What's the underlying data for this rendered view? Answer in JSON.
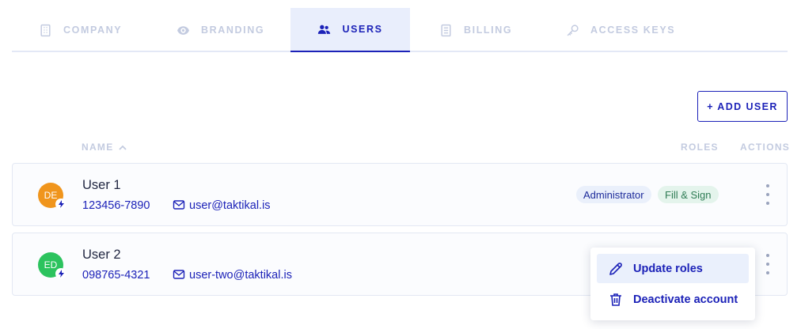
{
  "tabs": [
    {
      "label": "COMPANY",
      "icon": "building-icon"
    },
    {
      "label": "BRANDING",
      "icon": "eye-icon"
    },
    {
      "label": "USERS",
      "icon": "users-icon",
      "active": true
    },
    {
      "label": "BILLING",
      "icon": "document-icon"
    },
    {
      "label": "ACCESS KEYS",
      "icon": "key-icon"
    }
  ],
  "add_user_label": "+ ADD USER",
  "table": {
    "headers": {
      "name": "NAME",
      "roles": "ROLES",
      "actions": "ACTIONS"
    },
    "sort": "name-ascending",
    "rows": [
      {
        "initials": "DE",
        "avatar_color": "#f0951c",
        "name": "User 1",
        "phone": "123456-7890",
        "email": "user@taktikal.is",
        "roles": [
          "Administrator",
          "Fill & Sign"
        ]
      },
      {
        "initials": "ED",
        "avatar_color": "#2cc35e",
        "name": "User 2",
        "phone": "098765-4321",
        "email": "user-two@taktikal.is",
        "roles": []
      }
    ]
  },
  "menu": {
    "update_roles": "Update roles",
    "deactivate": "Deactivate account"
  },
  "colors": {
    "accent": "#1c22b8",
    "tab_inactive": "#c3cbe0",
    "active_tab_bg": "#e9eefc"
  }
}
